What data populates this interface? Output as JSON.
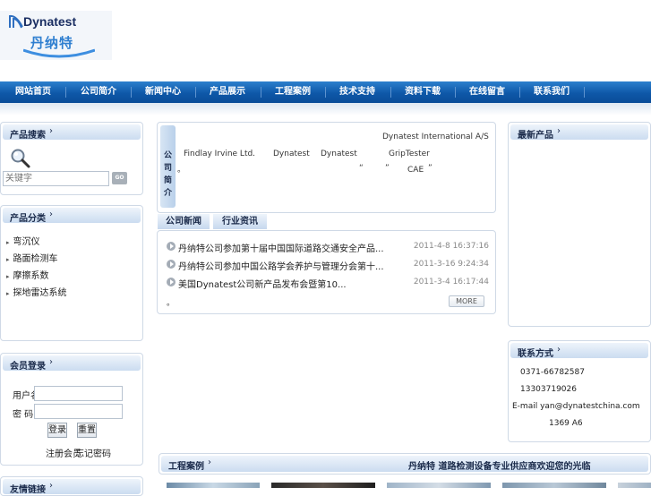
{
  "logo": {
    "brand": "Dynatest",
    "chinese": "丹纳特"
  },
  "nav": {
    "items": [
      "网站首页",
      "公司简介",
      "新闻中心",
      "产品展示",
      "工程案例",
      "技术支持",
      "资料下载",
      "在线留言",
      "联系我们"
    ]
  },
  "search": {
    "title": "产品搜索",
    "arrow": "›",
    "placeholder": "关键字",
    "button": "GO"
  },
  "categories": {
    "title": "产品分类",
    "arrow": "›",
    "items": [
      "弯沉仪",
      "路面检测车",
      "摩擦系数",
      "探地雷达系统"
    ]
  },
  "login": {
    "title": "会员登录",
    "arrow": "›",
    "username_label": "用户名：",
    "password_label": "密  码：",
    "login_button": "登录",
    "reset_button": "重置",
    "register_link": "注册会员",
    "forgot_link": "忘记密码"
  },
  "intro": {
    "side_label": [
      "公",
      "司",
      "简",
      "介"
    ],
    "lines": {
      "line1": "Dynatest International A/S",
      "f1": "Findlay Irvine Ltd.",
      "f2": "Dynatest",
      "f3": "Dynatest",
      "f4": "GripTester",
      "b1": "“",
      "b2": "”",
      "b3": "CAE",
      "b4": "”",
      "end_mark": "。"
    }
  },
  "news": {
    "tabs": [
      "公司新闻",
      "行业资讯"
    ],
    "items": [
      {
        "title": "丹纳特公司参加第十届中国国际道路交通安全产品...",
        "date": "2011-4-8 16:37:16"
      },
      {
        "title": "丹纳特公司参加中国公路学会养护与管理分会第十...",
        "date": "2011-3-16 9:24:34"
      },
      {
        "title": "美国Dynatest公司新产品发布会暨第10...",
        "date": "2011-3-4 16:17:44"
      }
    ],
    "end_mark": "。",
    "more": "MORE"
  },
  "right_top": {
    "title": "最新产品",
    "arrow": "›"
  },
  "contact": {
    "title": "联系方式",
    "arrow": "›",
    "phone": "0371-66782587",
    "mobile": "13303719026",
    "email": "E-mail yan@dynatestchina.com",
    "address": "1369 A6"
  },
  "cases": {
    "title": "工程案例",
    "arrow": "›",
    "headline": "丹纳特 道路检测设备专业供应商欢迎您的光临"
  },
  "bottom_left": {
    "title": "友情链接",
    "arrow": "›"
  },
  "colors": {
    "nav_blue": "#0e58a8",
    "panel_border": "#cfd9e6",
    "title_grad": "#cbdcf0"
  }
}
